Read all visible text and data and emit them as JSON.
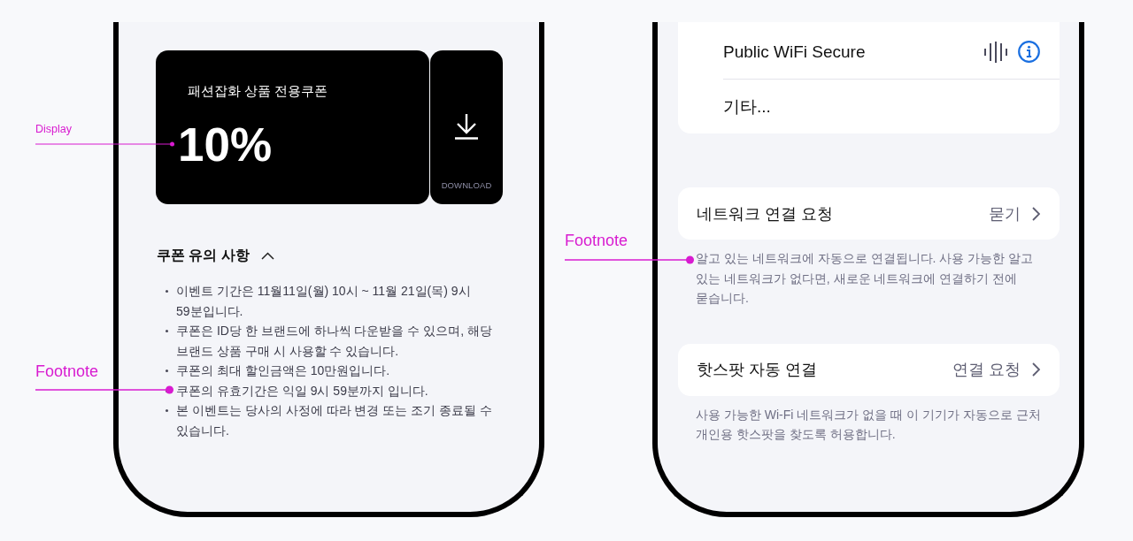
{
  "left_phone": {
    "coupon": {
      "title": "패션잡화 상품 전용쿠폰",
      "discount": "10%",
      "download_label": "DOWNLOAD"
    },
    "notice": {
      "title": "쿠폰 유의 사항",
      "expanded": true,
      "items": [
        "이벤트 기간은 11월11일(월) 10시 ~ 11월 21일(목) 9시 59분입니다.",
        "쿠폰은 ID당 한 브랜드에 하나씩 다운받을 수 있으며, 해당 브랜드 상품 구매 시 사용할 수 있습니다.",
        "쿠폰의 최대 할인금액은 10만원입니다.",
        "쿠폰의 유효기간은 익일 9시 59분까지 입니다.",
        "본 이벤트는 당사의 사정에 따라 변경 또는 조기 종료될 수 있습니다."
      ]
    }
  },
  "right_phone": {
    "networks": [
      {
        "name": "Public WiFi Secure",
        "kind": "network"
      },
      {
        "name": "기타...",
        "kind": "other"
      }
    ],
    "settings": [
      {
        "label": "네트워크 연결 요청",
        "value": "묻기",
        "footnote": "알고 있는 네트워크에 자동으로 연결됩니다. 사용 가능한 알고 있는 네트워크가 없다면, 새로운 네트워크에 연결하기 전에 묻습니다."
      },
      {
        "label": "핫스팟 자동 연결",
        "value": "연결 요청",
        "footnote": "사용 가능한 Wi-Fi 네트워크가 없을 때 이 기기가 자동으로 근처 개인용 핫스팟을 찾도록 허용합니다."
      }
    ]
  },
  "annotations": [
    {
      "label": "Display"
    },
    {
      "label": "Footnote"
    },
    {
      "label": "Footnote"
    }
  ]
}
